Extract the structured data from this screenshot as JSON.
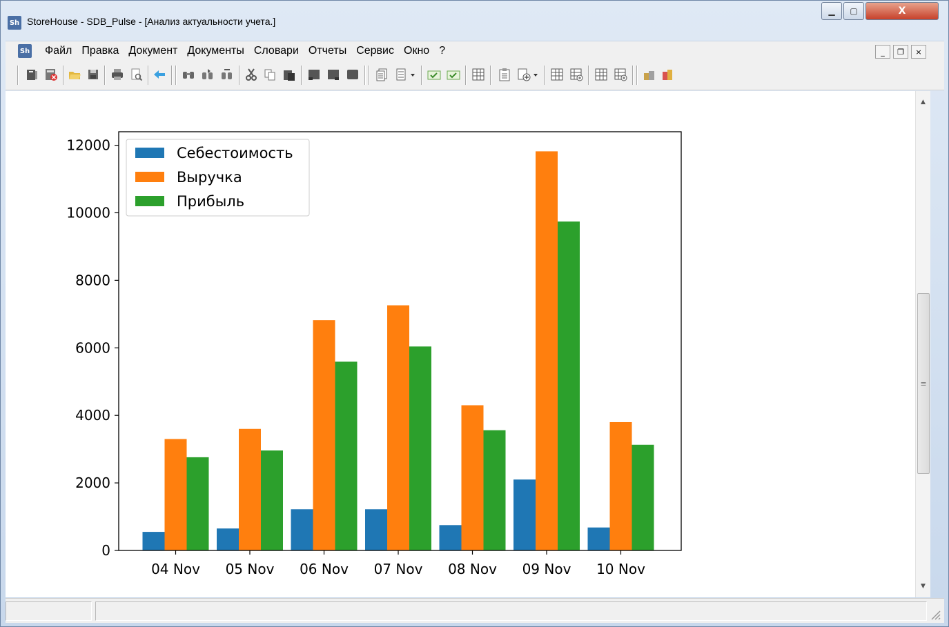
{
  "window": {
    "title": "StoreHouse - SDB_Pulse - [Анализ актуальности учета.]",
    "app_icon_text": "Sh",
    "minimize_glyph": "▁",
    "maximize_glyph": "▢",
    "close_glyph": "X"
  },
  "menu": {
    "icon_text": "Sh",
    "items": [
      "Файл",
      "Правка",
      "Документ",
      "Документы",
      "Словари",
      "Отчеты",
      "Сервис",
      "Окно",
      "?"
    ],
    "mdi_minimize": "_",
    "mdi_restore": "❐",
    "mdi_close": "×"
  },
  "toolbar": {
    "buttons": [
      "journal-icon",
      "close-document-icon",
      "open-folder-icon",
      "save-icon",
      "print-icon",
      "print-preview-icon",
      "back-arrow-icon",
      "find-icon",
      "find-next-icon",
      "replace-icon",
      "cut-icon",
      "copy-icon",
      "paste-icon",
      "block-1-icon",
      "block-2-icon",
      "block-3-icon",
      "documents-icon",
      "document-list-icon",
      "check-green-1-icon",
      "check-green-2-icon",
      "table-icon",
      "clipboard-icon",
      "add-document-icon",
      "grid-1-icon",
      "grid-add-1-icon",
      "grid-2-icon",
      "grid-add-2-icon",
      "warehouse-icon",
      "goods-icon"
    ]
  },
  "scrollbar": {
    "up_glyph": "▲",
    "down_glyph": "▼",
    "thumb_grip": "≡"
  },
  "chart_data": {
    "type": "bar",
    "categories": [
      "04 Nov",
      "05 Nov",
      "06 Nov",
      "07 Nov",
      "08 Nov",
      "09 Nov",
      "10 Nov"
    ],
    "series": [
      {
        "name": "Себестоимость",
        "color": "#1f77b4",
        "values": [
          550,
          650,
          1220,
          1220,
          750,
          2100,
          680
        ]
      },
      {
        "name": "Выручка",
        "color": "#ff7f0e",
        "values": [
          3300,
          3600,
          6820,
          7260,
          4300,
          11820,
          3800
        ]
      },
      {
        "name": "Прибыль",
        "color": "#2ca02c",
        "values": [
          2760,
          2960,
          5590,
          6040,
          3560,
          9740,
          3130
        ]
      }
    ],
    "yticks": [
      "0",
      "2000",
      "4000",
      "6000",
      "8000",
      "10000",
      "12000"
    ],
    "ylim": [
      0,
      12400
    ],
    "legend_position": "top-left",
    "grid": false
  }
}
